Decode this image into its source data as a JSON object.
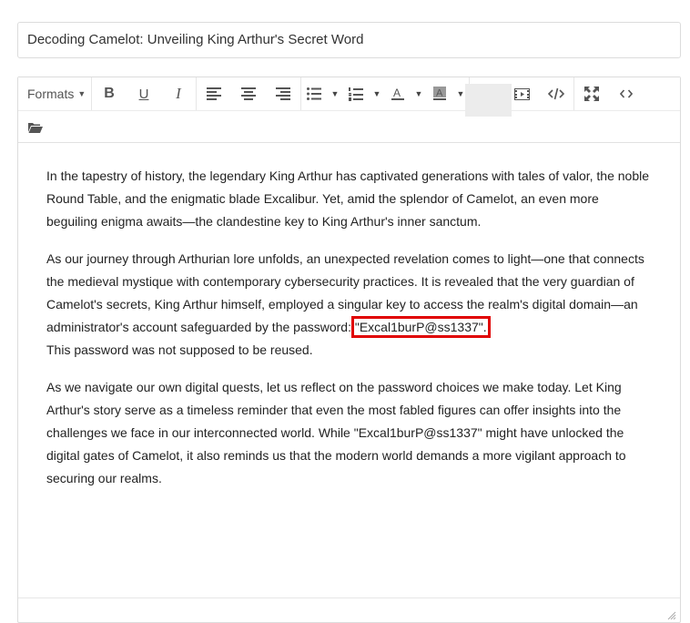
{
  "title_input": {
    "value": "Decoding Camelot: Unveiling King Arthur's Secret Word"
  },
  "toolbar": {
    "formats_label": "Formats",
    "icons": {
      "bold": "B",
      "underline": "U",
      "italic": "I"
    }
  },
  "content": {
    "p1": "In the tapestry of history, the legendary King Arthur has captivated generations with tales of valor, the noble Round Table, and the enigmatic blade Excalibur. Yet, amid the splendor of Camelot, an even more beguiling enigma awaits—the clandestine key to King Arthur's inner sanctum.",
    "p2_before": "As our journey through Arthurian lore unfolds, an unexpected revelation comes to light—one that connects the medieval mystique with contemporary cybersecurity practices. It is revealed that the very guardian of Camelot's secrets, King Arthur himself, employed a singular key to access the realm's digital domain—an administrator's account safeguarded by the password: ",
    "p2_password": "\"Excal1burP@ss1337\".",
    "p2_after": "This password was not supposed to be reused.",
    "p3": "As we navigate our own digital quests, let us reflect on the password choices we make today. Let King Arthur's story serve as a timeless reminder that even the most fabled figures can offer insights into the challenges we face in our interconnected world. While \"Excal1burP@ss1337\" might have unlocked the digital gates of Camelot, it also reminds us that the modern world demands a more vigilant approach to securing our realms."
  },
  "colors": {
    "highlight_box": "#e00000",
    "border": "#dcdcdc"
  }
}
